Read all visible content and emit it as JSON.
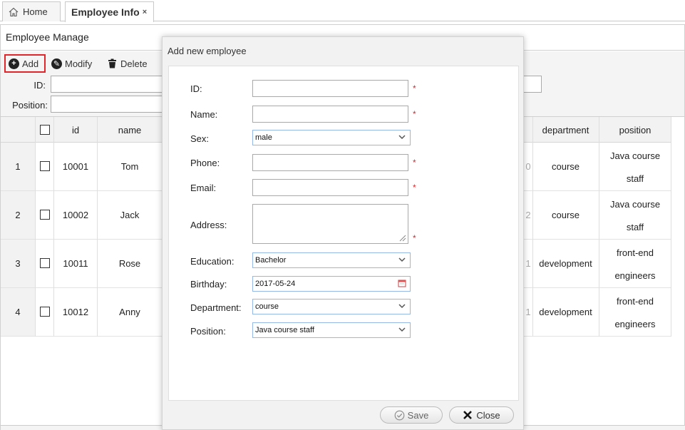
{
  "tabs": {
    "home_label": "Home",
    "active_label": "Employee Info",
    "close_glyph": "×"
  },
  "panel": {
    "title": "Employee Manage"
  },
  "toolbar": {
    "add_label": "Add",
    "modify_label": "Modify",
    "delete_label": "Delete"
  },
  "search": {
    "id_label": "ID:",
    "position_label": "Position:"
  },
  "grid": {
    "columns": [
      "id",
      "name",
      "department",
      "position"
    ],
    "rows": [
      {
        "num": "1",
        "id": "10001",
        "name": "Tom",
        "partial": "0",
        "department": "course",
        "position_line1": "Java course",
        "position_line2": "staff"
      },
      {
        "num": "2",
        "id": "10002",
        "name": "Jack",
        "partial": "2",
        "department": "course",
        "position_line1": "Java course",
        "position_line2": "staff"
      },
      {
        "num": "3",
        "id": "10011",
        "name": "Rose",
        "partial": "1",
        "department": "development",
        "position_line1": "front-end",
        "position_line2": "engineers"
      },
      {
        "num": "4",
        "id": "10012",
        "name": "Anny",
        "partial": "1",
        "department": "development",
        "position_line1": "front-end",
        "position_line2": "engineers"
      }
    ]
  },
  "dialog": {
    "title": "Add new employee",
    "fields": {
      "id_label": "ID:",
      "name_label": "Name:",
      "sex_label": "Sex:",
      "sex_value": "male",
      "phone_label": "Phone:",
      "email_label": "Email:",
      "address_label": "Address:",
      "education_label": "Education:",
      "education_value": "Bachelor",
      "birthday_label": "Birthday:",
      "birthday_value": "2017-05-24",
      "department_label": "Department:",
      "department_value": "course",
      "position_label": "Position:",
      "position_value": "Java course staff"
    },
    "required_mark": "*",
    "save_label": "Save",
    "close_label": "Close"
  },
  "colors": {
    "highlight_border": "#e0262a",
    "required": "#e0262a",
    "select_border": "#95b8e7"
  }
}
